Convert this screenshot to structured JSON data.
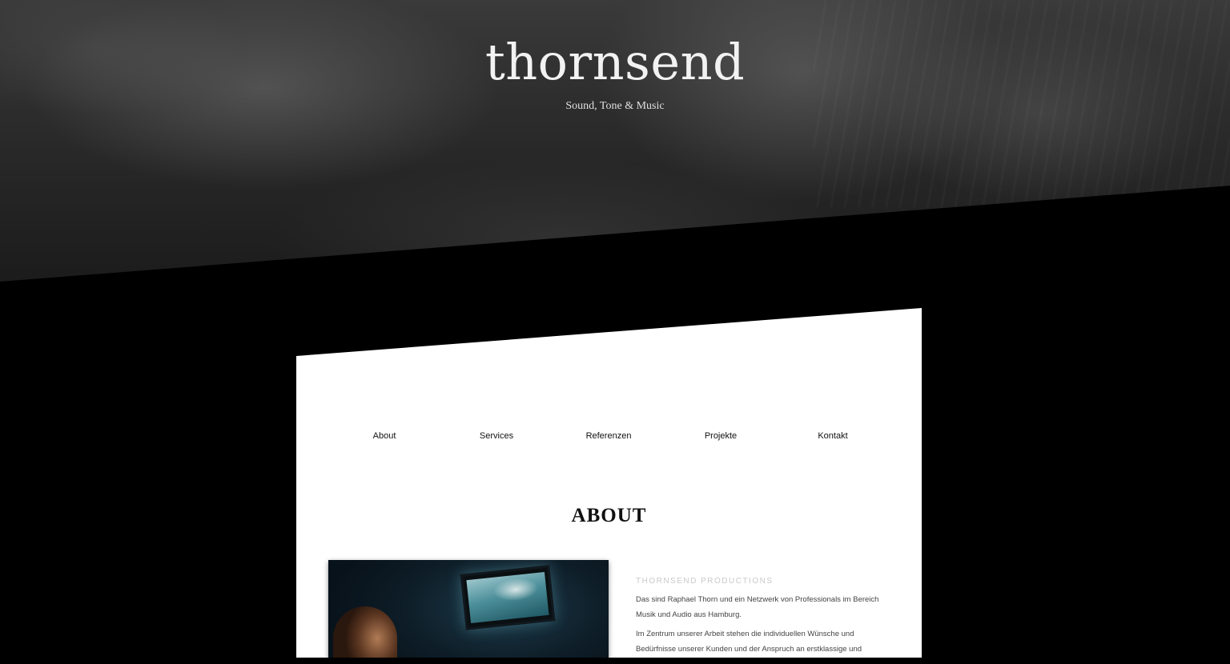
{
  "hero": {
    "title": "thornsend",
    "subtitle": "Sound, Tone & Music"
  },
  "nav": {
    "items": [
      {
        "label": "About"
      },
      {
        "label": "Services"
      },
      {
        "label": "Referenzen"
      },
      {
        "label": "Projekte"
      },
      {
        "label": "Kontakt"
      }
    ]
  },
  "about": {
    "title": "ABOUT",
    "kicker": "THORNSEND PRODUCTIONS",
    "paragraphs": [
      "Das sind Raphael Thorn und ein Netzwerk von Professionals im Bereich Musik und Audio aus Hamburg.",
      "Im Zentrum unserer Arbeit stehen die individuellen Wünsche und Bedürfnisse unserer Kunden und der Anspruch an erstklassige und"
    ]
  },
  "colors": {
    "page_background": "#000000",
    "card_background": "#ffffff",
    "hero_text": "#f2f2f2"
  }
}
